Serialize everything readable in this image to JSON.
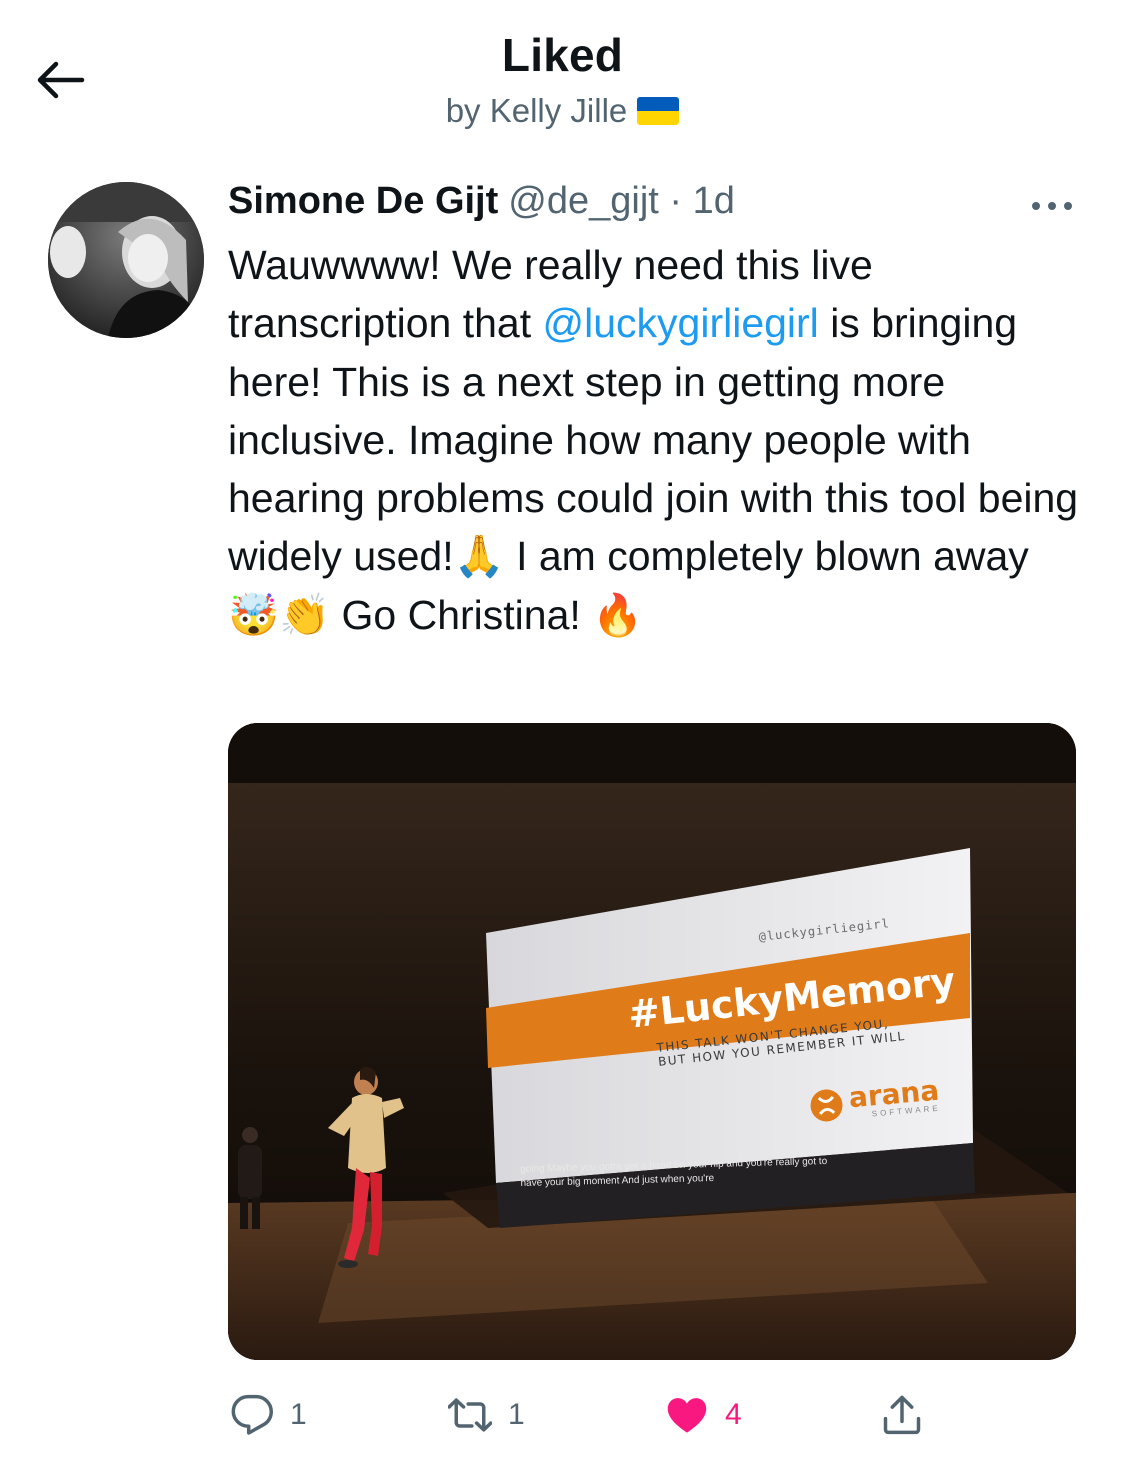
{
  "header": {
    "back_icon": "arrow-left-icon",
    "title": "Liked",
    "subtitle": "by Kelly Jille",
    "subtitle_flag": "ukraine-flag",
    "flag_colors": [
      "#005bbb",
      "#ffd500"
    ]
  },
  "tweet": {
    "author_name": "Simone De Gijt",
    "handle": "@de_gijt",
    "separator": "·",
    "timestamp": "1d",
    "more_icon": "more-dots-icon",
    "text_part1": "Wauwwww! We really need this live transcription that ",
    "mention": "@luckygirliegirl",
    "text_part2": " is bringing here! This is a next step in getting more inclusive. Imagine how many people with hearing problems could join with this tool being widely used!",
    "emoji_pray": "🙏",
    "text_part3": " I am completely blown away ",
    "emoji_mindblown": "🤯",
    "emoji_clap": "👏",
    "text_part4": " Go Christina! ",
    "emoji_fire": "🔥",
    "link_color": "#1d9bf0",
    "media": {
      "slide_handle": "@luckygirliegirl",
      "slide_hashtag": "#LuckyMemory",
      "slide_tagline_1": "THIS TALK WON'T CHANGE YOU,",
      "slide_tagline_2": "BUT HOW YOU REMEMBER IT WILL",
      "slide_logo": "arana",
      "slide_logo_sub": "SOFTWARE",
      "caption_1": "going Maybe you gotta get a hand on your hip and you're really got to",
      "caption_2": "have your big moment And just when you're",
      "accent": "#e07b1a"
    }
  },
  "actions": {
    "reply_icon": "reply-icon",
    "reply_count": "1",
    "retweet_icon": "retweet-icon",
    "retweet_count": "1",
    "like_icon": "heart-filled-icon",
    "like_count": "4",
    "like_color": "#f91880",
    "share_icon": "share-icon"
  }
}
